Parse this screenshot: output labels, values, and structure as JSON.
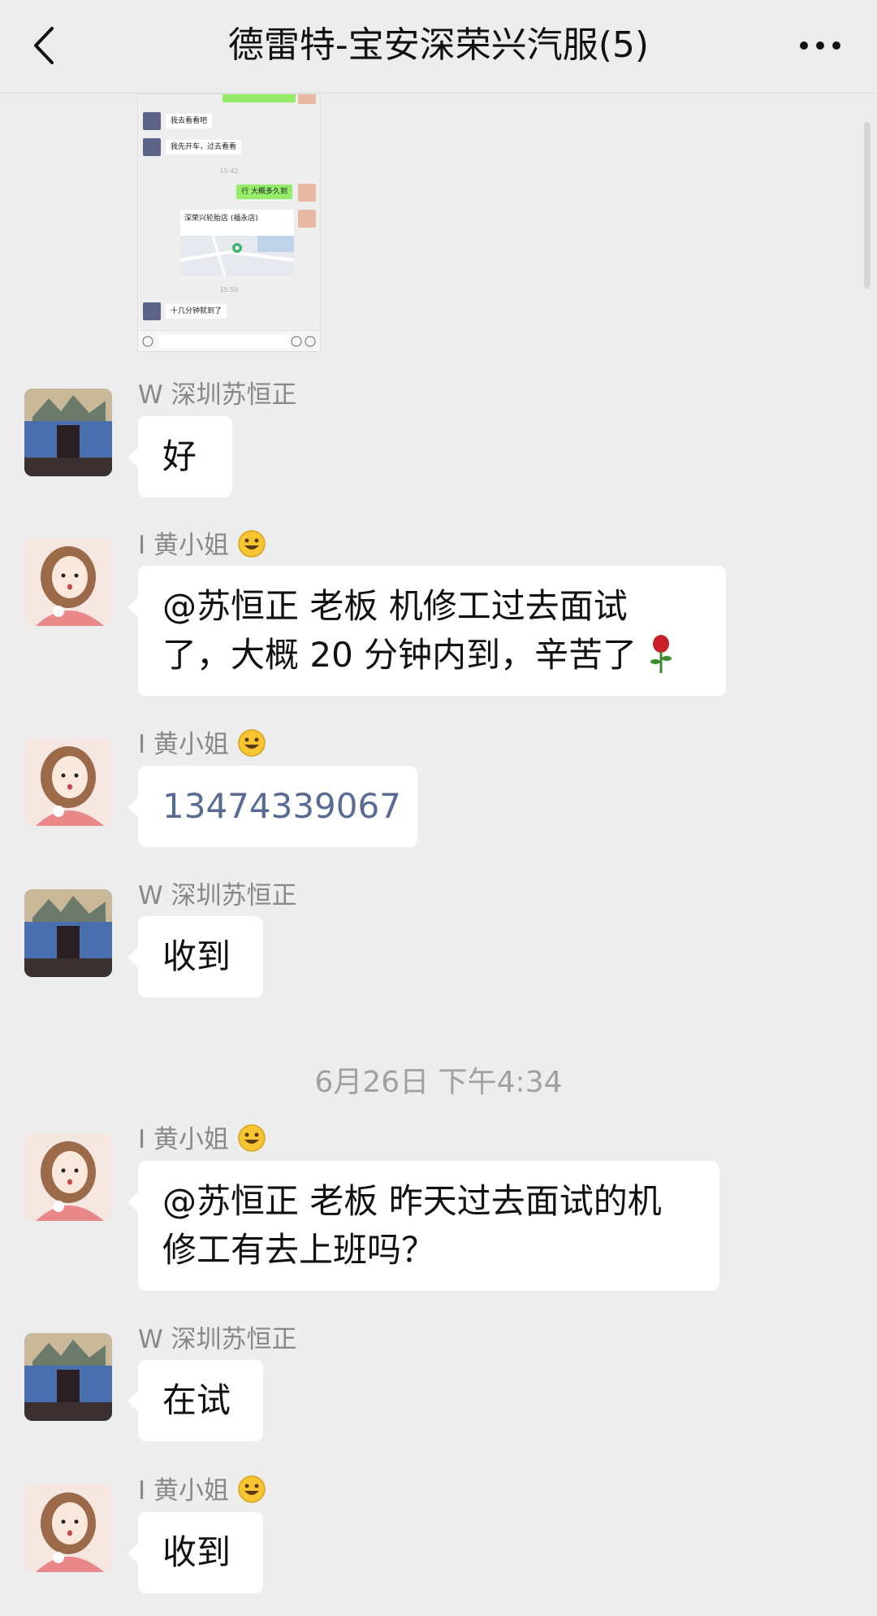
{
  "header": {
    "title": "德雷特-宝安深荣兴汽服(5)",
    "back_icon": "chevron-left-icon",
    "more_icon": "more-dots-icon"
  },
  "embedded_screenshot": {
    "lines": {
      "l1": "我去看看吧",
      "l2": "我先开车，过去看看",
      "t1": "15:42",
      "l3": "行 大概多久到",
      "loc_title": "深荣兴轮胎店 (福永店)",
      "t2": "15:59",
      "l4": "十几分钟就到了"
    }
  },
  "messages": [
    {
      "sender": "W 深圳苏恒正",
      "text": "好"
    },
    {
      "sender": "I 黄小姐",
      "text_line1": "@苏恒正 老板 机修工过去面试",
      "text_line2": "了，大概 20 分钟内到，辛苦了"
    },
    {
      "sender": "I 黄小姐",
      "text": "13474339067"
    },
    {
      "sender": "W 深圳苏恒正",
      "text": "收到"
    },
    {
      "sender": "I 黄小姐",
      "text_line1": "@苏恒正 老板 昨天过去面试的机",
      "text_line2": "修工有去上班吗？"
    },
    {
      "sender": "W 深圳苏恒正",
      "text": "在试"
    },
    {
      "sender": "I 黄小姐",
      "text": "收到"
    }
  ],
  "timestamp": "6月26日 下午4:34",
  "colors": {
    "background": "#ededed",
    "bubble": "#ffffff",
    "phone_link": "#576b95",
    "sender_name": "#888888"
  }
}
